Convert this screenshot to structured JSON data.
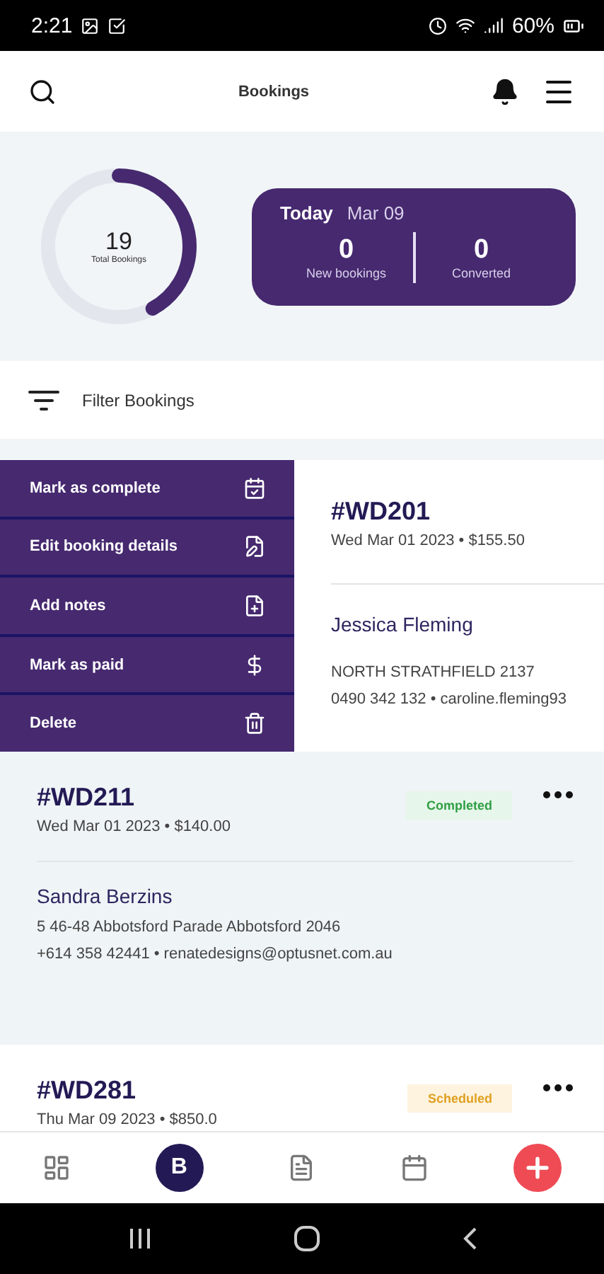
{
  "status_bar": {
    "time": "2:21",
    "battery": "60%"
  },
  "header": {
    "title": "Bookings"
  },
  "summary": {
    "total": "19",
    "total_label": "Total Bookings",
    "level": 0.42,
    "today_label": "Today",
    "today_date": "Mar 09",
    "stats": [
      {
        "value": "0",
        "label": "New bookings"
      },
      {
        "value": "0",
        "label": "Converted"
      }
    ]
  },
  "filter": {
    "label": "Filter Bookings"
  },
  "bookings": [
    {
      "id": "#WD201",
      "meta": "Wed Mar 01 2023 • $155.50",
      "name": "Jessica Fleming",
      "address": "NORTH STRATHFIELD 2137",
      "contact": "0490 342 132 • caroline.fleming93",
      "swiped": true,
      "highlighted": false,
      "actions": [
        {
          "label": "Mark as complete",
          "kind": "complete"
        },
        {
          "label": "Edit booking details",
          "kind": "edit"
        },
        {
          "label": "Add notes",
          "kind": "notes"
        },
        {
          "label": "Mark as paid",
          "kind": "paid"
        },
        {
          "label": "Delete",
          "kind": "delete"
        }
      ]
    },
    {
      "id": "#WD211",
      "meta": "Wed Mar 01 2023 • $140.00",
      "status": {
        "label": "Completed",
        "kind": "completed"
      },
      "name": "Sandra Berzins",
      "address": "5 46-48 Abbotsford Parade Abbotsford 2046",
      "contact": "+614 358 42441 • renatedesigns@optusnet.com.au",
      "swiped": false,
      "highlighted": true
    },
    {
      "id": "#WD281",
      "meta": "Thu Mar 09 2023 • $850.0",
      "status": {
        "label": "Scheduled",
        "kind": "scheduled"
      },
      "swiped": false,
      "highlighted": false
    }
  ],
  "bottom_nav": [
    {
      "kind": "dashboard",
      "selected": false
    },
    {
      "kind": "bookings",
      "label": "B",
      "selected": true
    },
    {
      "kind": "documents",
      "selected": false
    },
    {
      "kind": "calendar",
      "selected": false
    },
    {
      "kind": "add",
      "selected": false
    }
  ]
}
